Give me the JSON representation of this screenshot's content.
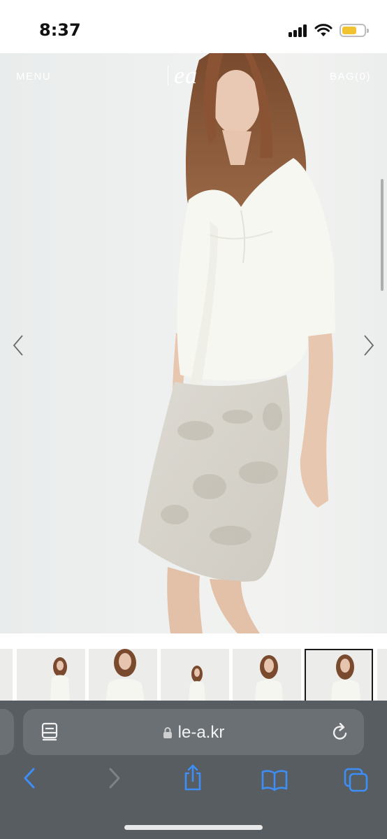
{
  "status_bar": {
    "time": "8:37"
  },
  "site": {
    "menu_label": "MENU",
    "logo_text": "ea",
    "bag_label": "BAG(0)"
  },
  "gallery": {
    "thumbnail_count": 5,
    "active_index": 4
  },
  "browser": {
    "url": "le-a.kr"
  },
  "colors": {
    "browser_bar": "#585d61",
    "url_pill": "#6b7074",
    "accent_blue": "#3e8ef7"
  },
  "icons": {
    "back": "chevron-left-icon",
    "forward": "chevron-right-icon",
    "share": "share-icon",
    "bookmarks": "book-icon",
    "tabs": "tabs-icon",
    "reader": "reader-icon",
    "reload": "reload-icon",
    "lock": "lock-icon"
  }
}
